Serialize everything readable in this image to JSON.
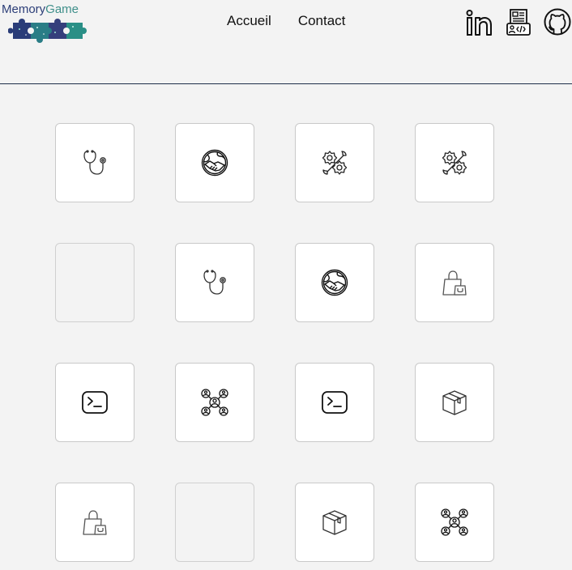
{
  "logo": {
    "part1": "Memory",
    "part2": "Game",
    "colors": {
      "part1": "#2c3e78",
      "part2": "#3f8f8a"
    }
  },
  "nav": {
    "home": "Accueil",
    "contact": "Contact"
  },
  "social": {
    "linkedin_label": "in"
  },
  "cards": [
    {
      "icon": "stethoscope-icon",
      "state": "revealed"
    },
    {
      "icon": "globe-handshake-icon",
      "state": "revealed"
    },
    {
      "icon": "gear-wrench-icon",
      "state": "revealed"
    },
    {
      "icon": "gear-wrench-icon",
      "state": "revealed"
    },
    {
      "icon": "",
      "state": "hidden"
    },
    {
      "icon": "stethoscope-icon",
      "state": "revealed"
    },
    {
      "icon": "globe-handshake-icon",
      "state": "revealed"
    },
    {
      "icon": "shopping-bag-icon",
      "state": "revealed"
    },
    {
      "icon": "terminal-icon",
      "state": "revealed"
    },
    {
      "icon": "network-users-icon",
      "state": "revealed"
    },
    {
      "icon": "terminal-icon",
      "state": "revealed"
    },
    {
      "icon": "package-box-icon",
      "state": "revealed"
    },
    {
      "icon": "shopping-bag-icon",
      "state": "revealed"
    },
    {
      "icon": "",
      "state": "hidden"
    },
    {
      "icon": "package-box-icon",
      "state": "revealed"
    },
    {
      "icon": "network-users-icon",
      "state": "revealed"
    }
  ]
}
